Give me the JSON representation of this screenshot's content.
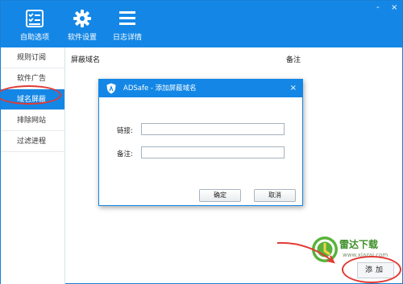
{
  "toolbar": {
    "items": [
      {
        "label": "自助选项",
        "icon": "checklist-icon"
      },
      {
        "label": "软件设置",
        "icon": "gear-icon"
      },
      {
        "label": "日志详情",
        "icon": "log-list-icon"
      }
    ],
    "window_controls": {
      "minimize": "-",
      "close": "×"
    }
  },
  "sidebar": {
    "items": [
      {
        "label": "规则订阅"
      },
      {
        "label": "软件广告"
      },
      {
        "label": "域名屏蔽",
        "active": true
      },
      {
        "label": "排除网站"
      },
      {
        "label": "过滤进程"
      }
    ]
  },
  "main": {
    "columns": [
      "屏蔽域名",
      "备注"
    ],
    "add_button": "添加"
  },
  "dialog": {
    "title": "ADSafe - 添加屏蔽域名",
    "close": "×",
    "link_label": "链接:",
    "link_value": "",
    "note_label": "备注:",
    "note_value": "",
    "ok": "确定",
    "cancel": "取消"
  },
  "watermark": {
    "name": "雷达下载",
    "url": "www.xiazai.com"
  },
  "colors": {
    "accent": "#1487e6",
    "annotation": "#e03a32"
  }
}
